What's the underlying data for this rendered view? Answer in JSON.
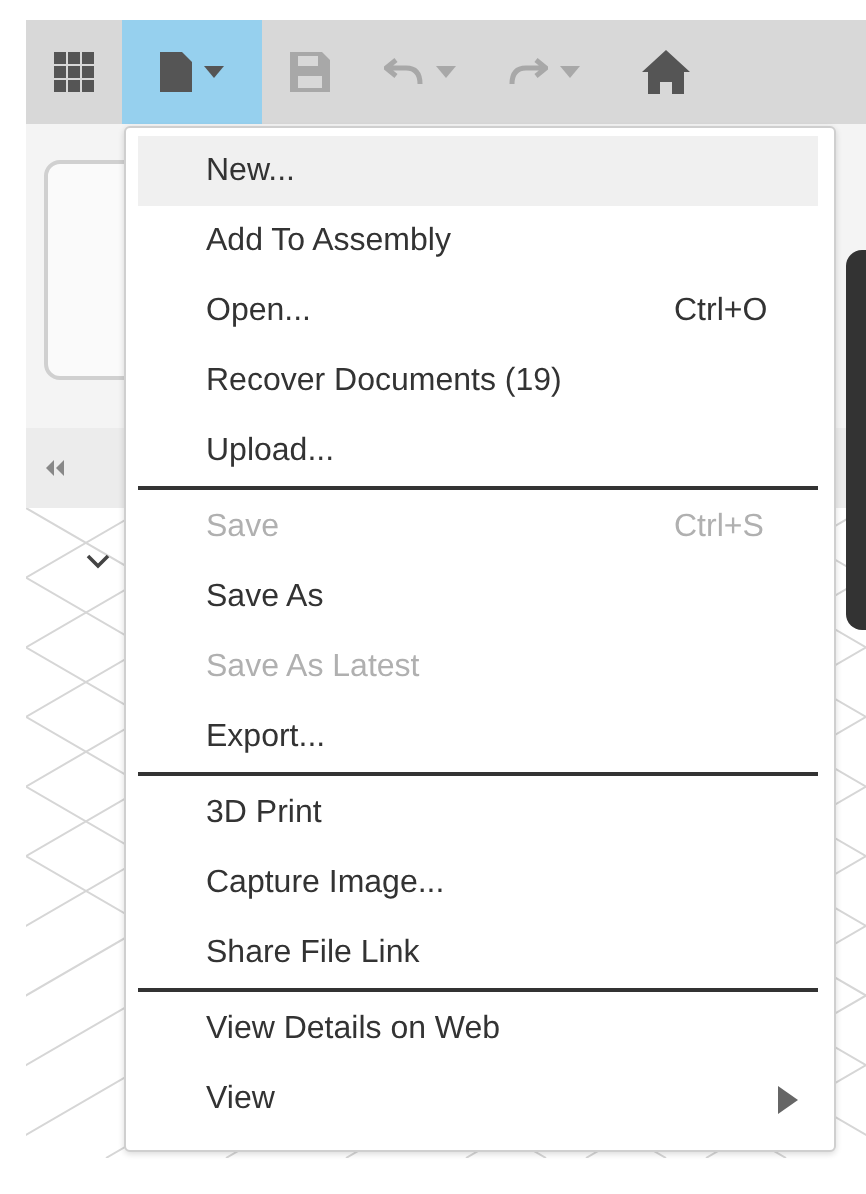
{
  "toolbar": {
    "buttons": [
      {
        "kind": "apps",
        "active": false,
        "disabled": false
      },
      {
        "kind": "file",
        "active": true,
        "disabled": false
      },
      {
        "kind": "save",
        "active": false,
        "disabled": true
      },
      {
        "kind": "undo",
        "active": false,
        "disabled": true
      },
      {
        "kind": "redo",
        "active": false,
        "disabled": true
      },
      {
        "kind": "home",
        "active": false,
        "disabled": false
      }
    ]
  },
  "file_menu": {
    "groups": [
      {
        "items": [
          {
            "label": "New...",
            "selected": true,
            "disabled": false
          },
          {
            "label": "Add To Assembly",
            "selected": false,
            "disabled": false
          },
          {
            "label": "Open...",
            "shortcut": "Ctrl+O",
            "selected": false,
            "disabled": false
          },
          {
            "label": "Recover Documents (19)",
            "selected": false,
            "disabled": false
          },
          {
            "label": "Upload...",
            "selected": false,
            "disabled": false
          }
        ]
      },
      {
        "items": [
          {
            "label": "Save",
            "shortcut": "Ctrl+S",
            "selected": false,
            "disabled": true
          },
          {
            "label": "Save As",
            "selected": false,
            "disabled": false
          },
          {
            "label": "Save As Latest",
            "selected": false,
            "disabled": true
          },
          {
            "label": "Export...",
            "selected": false,
            "disabled": false
          }
        ]
      },
      {
        "items": [
          {
            "label": "3D Print",
            "selected": false,
            "disabled": false
          },
          {
            "label": "Capture Image...",
            "selected": false,
            "disabled": false
          },
          {
            "label": "Share File Link",
            "selected": false,
            "disabled": false
          }
        ]
      },
      {
        "items": [
          {
            "label": "View Details on Web",
            "selected": false,
            "disabled": false
          },
          {
            "label": "View",
            "submenu": true,
            "selected": false,
            "disabled": false
          }
        ]
      }
    ]
  }
}
